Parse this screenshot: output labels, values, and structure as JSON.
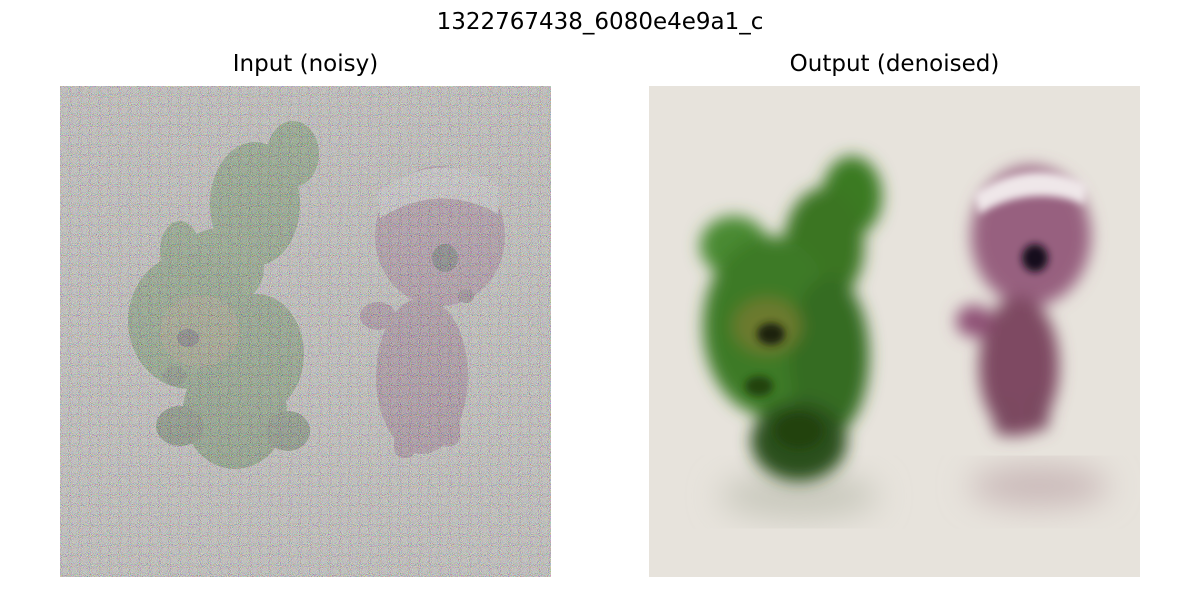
{
  "figure": {
    "title": "1322767438_6080e4e9a1_c"
  },
  "panels": [
    {
      "title": "Input (noisy)"
    },
    {
      "title": "Output (denoised)"
    }
  ],
  "colors": {
    "background_floor": "#e7e3dc",
    "green_figure": "#3f7a28",
    "green_figure_dark": "#20420f",
    "pink_figure": "#8e4f74",
    "pink_figure_dark": "#5a2d46",
    "hat_white": "#efe7e9"
  }
}
